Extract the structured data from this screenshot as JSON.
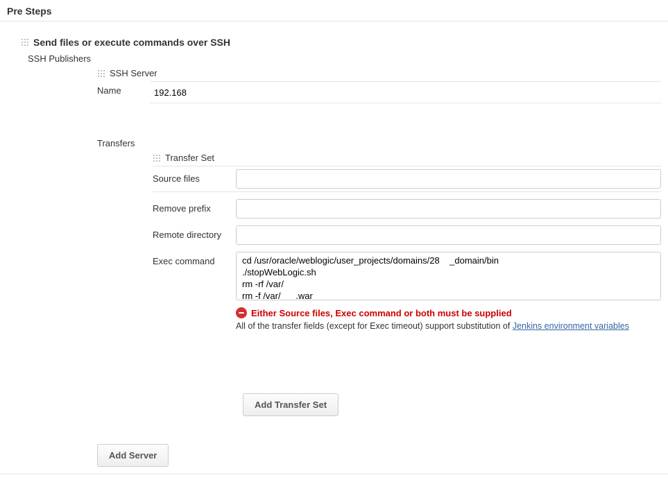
{
  "section": {
    "title": "Pre Steps"
  },
  "builder": {
    "title": "Send files or execute commands over SSH",
    "publishers_label": "SSH Publishers"
  },
  "ssh_server": {
    "header": "SSH Server",
    "name_label": "Name",
    "name_value": "192.168"
  },
  "transfers": {
    "label": "Transfers",
    "set_header": "Transfer Set",
    "source_files_label": "Source files",
    "source_files_value": "",
    "remove_prefix_label": "Remove prefix",
    "remove_prefix_value": "",
    "remote_directory_label": "Remote directory",
    "remote_directory_value": "",
    "exec_command_label": "Exec command",
    "exec_command_value": "cd /usr/oracle/weblogic/user_projects/domains/28    _domain/bin\n./stopWebLogic.sh\nrm -rf /var/\nrm -f /var/      .war"
  },
  "error": {
    "message": "Either Source files, Exec command or both must be supplied",
    "hint_prefix": "All of the transfer fields (except for Exec timeout) support substitution of ",
    "hint_link": "Jenkins environment variables"
  },
  "buttons": {
    "add_transfer_set": "Add Transfer Set",
    "add_server": "Add Server"
  }
}
